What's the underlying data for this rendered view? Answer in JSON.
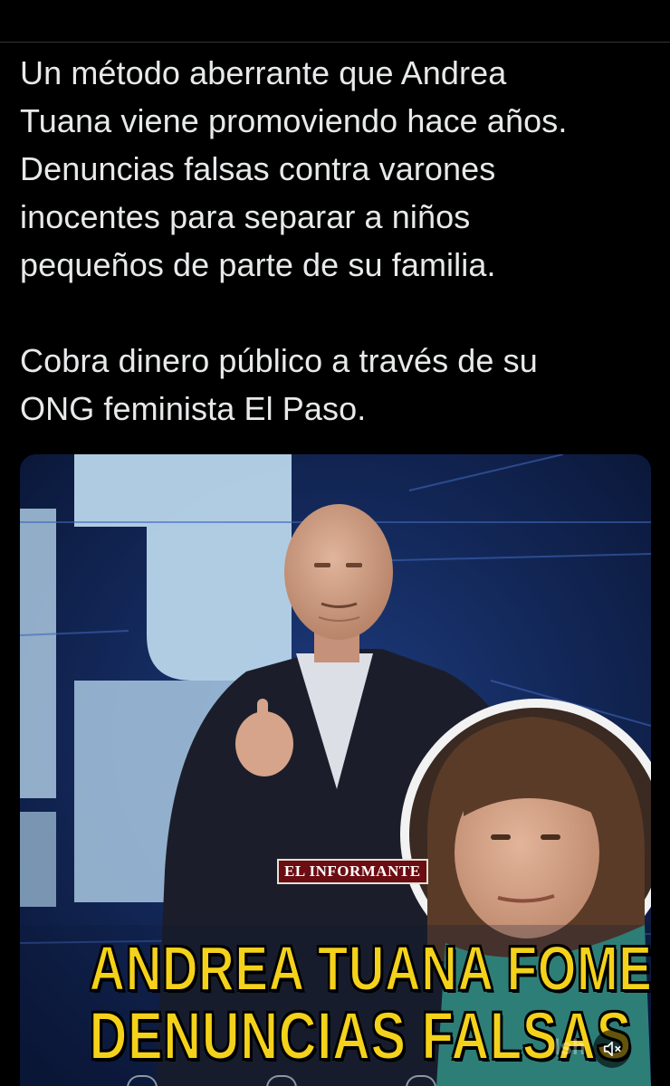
{
  "tweet": {
    "paragraph_1_lines": [
      "Un método aberrante que Andrea",
      "Tuana viene promoviendo hace años.",
      "Denuncias falsas contra varones",
      "inocentes para separar a niños",
      "pequeños de parte de su familia."
    ],
    "paragraph_2_lines": [
      "Cobra dinero público a través de su",
      "ONG feminista El Paso."
    ]
  },
  "media": {
    "watermark": "EL INFORMANTE",
    "caption_line_1": "ANDREA TUANA FOMENTA",
    "caption_line_2": "DENUNCIAS FALSAS",
    "mute_icon": "muted-speaker-icon",
    "corner_watermark": "lsh"
  },
  "colors": {
    "background": "#000000",
    "text": "#e7e9ea",
    "caption": "#f4d21b",
    "watermark_bg": "#6b0d12"
  }
}
